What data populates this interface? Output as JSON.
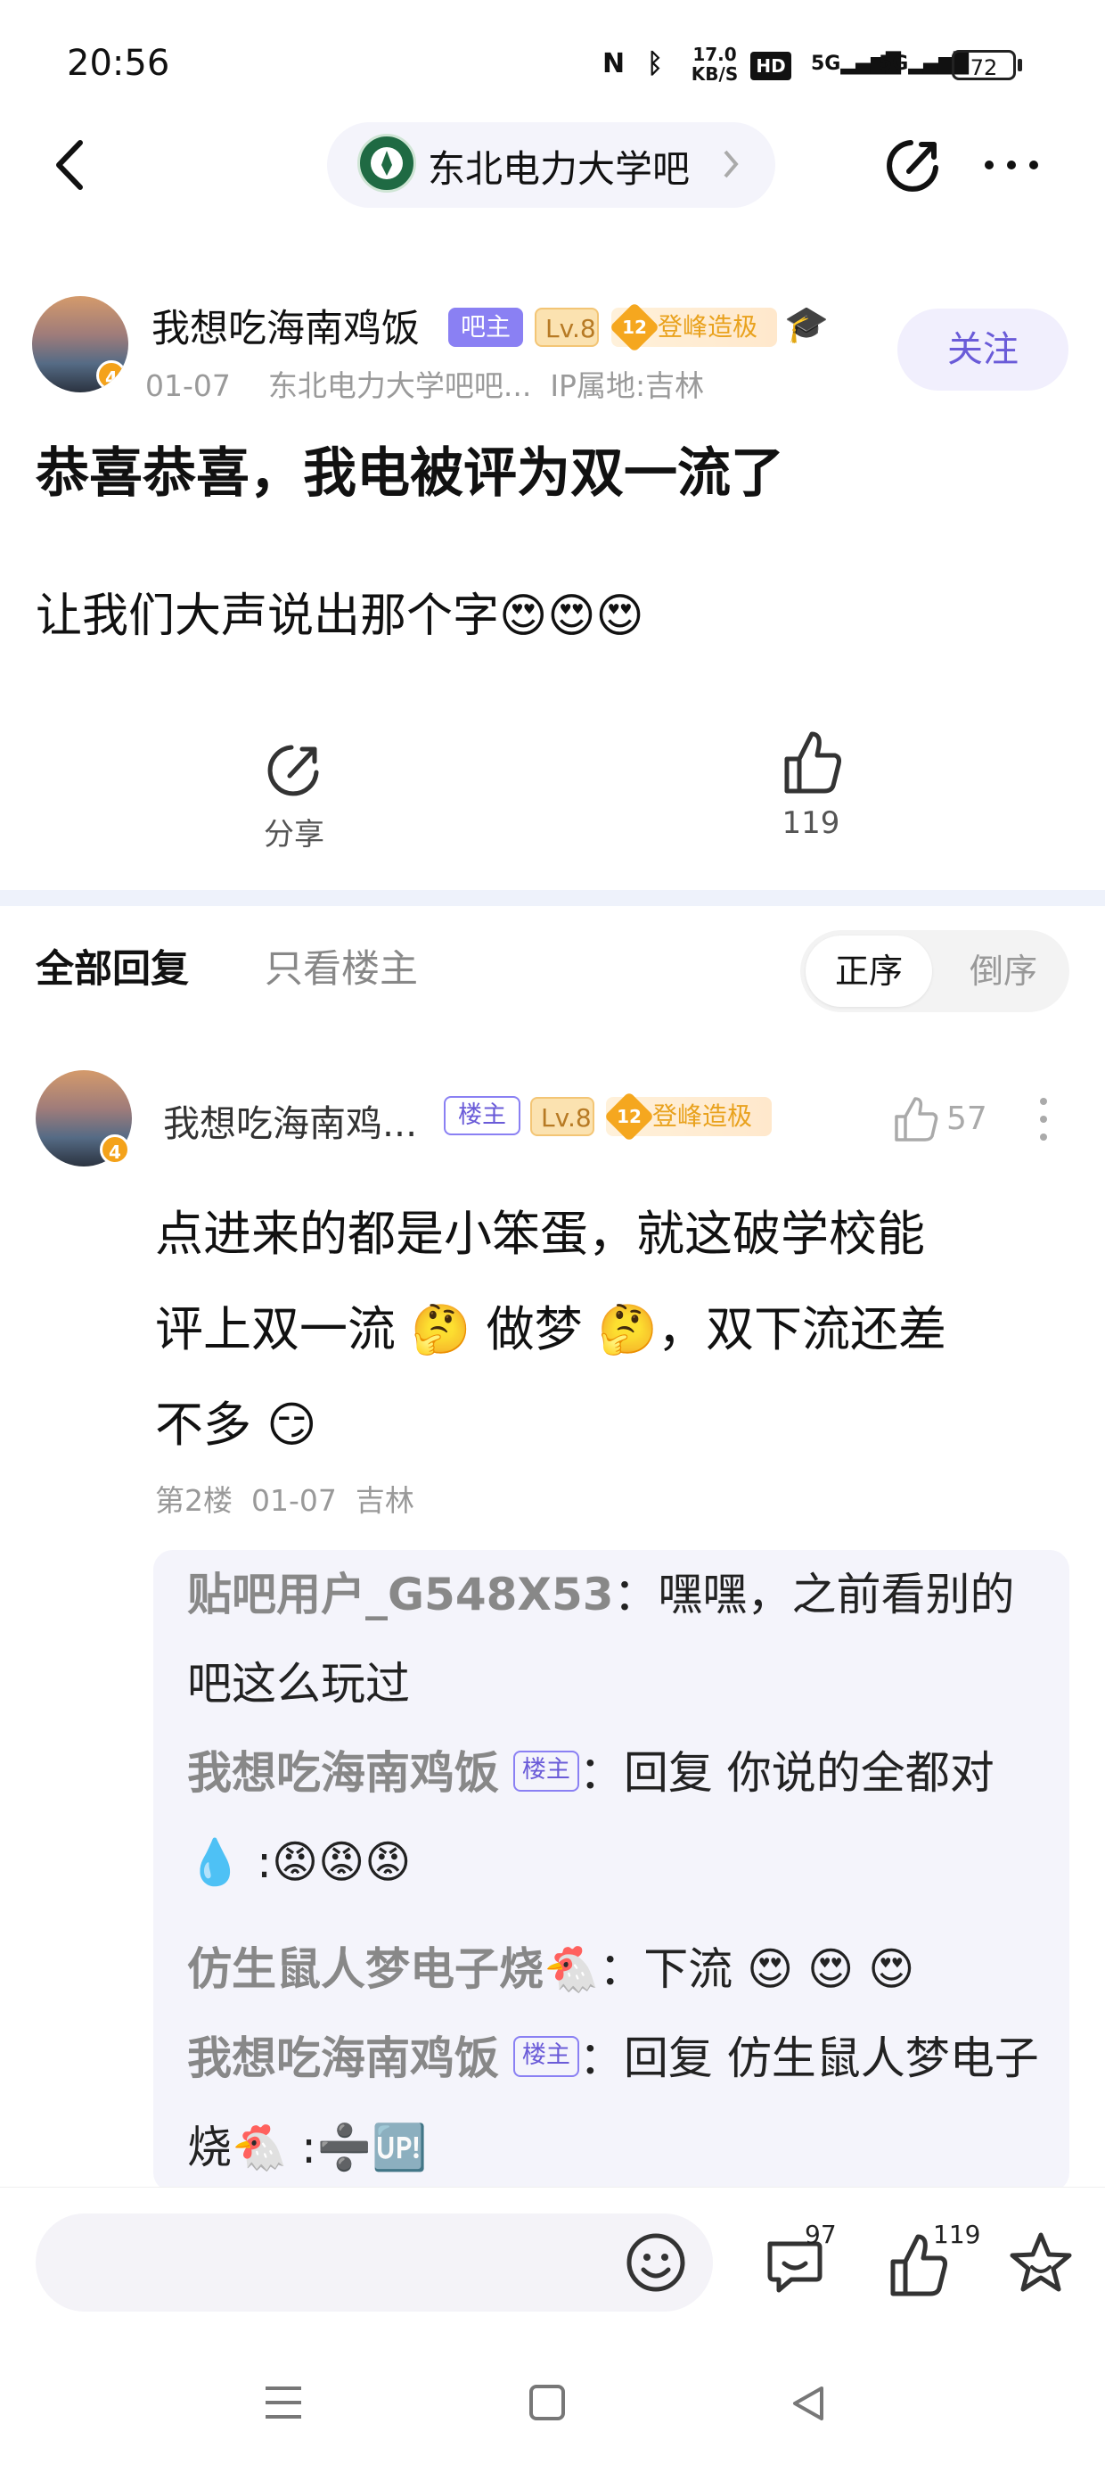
{
  "status_bar": {
    "time": "20:56",
    "net_speed": "17.0 KB/S",
    "battery": "72",
    "icons": [
      "nfc-icon",
      "bluetooth-icon",
      "hd-icon",
      "signal-5g-icon",
      "signal-5g-icon"
    ]
  },
  "nav": {
    "forum_name": "东北电力大学吧"
  },
  "post": {
    "author": "我想吃海南鸡饭",
    "badge_bazhu": "吧主",
    "level": "Lv.8",
    "title_rank_num": "12",
    "title_rank": "登峰造极",
    "date": "01-07",
    "forum_ref": "东北电力大学吧吧...",
    "ip": "IP属地:吉林",
    "follow_label": "关注",
    "title": "恭喜恭喜，我电被评为双一流了",
    "body_text": "让我们大声说出那个字",
    "body_emoji": "😍😍😍",
    "share_label": "分享",
    "like_count": "119"
  },
  "tabs": {
    "all": "全部回复",
    "op_only": "只看楼主",
    "sort_asc": "正序",
    "sort_desc": "倒序"
  },
  "reply": {
    "author": "我想吃海南鸡...",
    "badge_lz": "楼主",
    "level": "Lv.8",
    "title_rank_num": "12",
    "title_rank": "登峰造极",
    "like_count": "57",
    "line1": "点进来的都是小笨蛋，就这破学校能",
    "line2a": "评上双一流 ",
    "emoji_think": "🤔",
    "line2b": " 做梦 ",
    "line2c": "，双下流还差",
    "line3": "不多 ",
    "emoji_smirk": "😏",
    "floor": "第2楼",
    "date": "01-07",
    "location": "吉林"
  },
  "subreplies": [
    {
      "who": "贴吧用户_G548X53",
      "text": "：嘿嘿，之前看别的吧这么玩过"
    },
    {
      "who": "我想吃海南鸡饭",
      "lz": "楼主",
      "text": "：回复 你说的全都对💧 :😡😡😡"
    },
    {
      "who": "仿生鼠人梦电子烧🐔",
      "text": "：下流 😍 😍 😍"
    },
    {
      "who": "我想吃海南鸡饭",
      "lz": "楼主",
      "text": "：回复 仿生鼠人梦电子烧🐔 :➗🆙"
    }
  ],
  "bottom_bar": {
    "reply_count": "97",
    "like_count": "119"
  }
}
